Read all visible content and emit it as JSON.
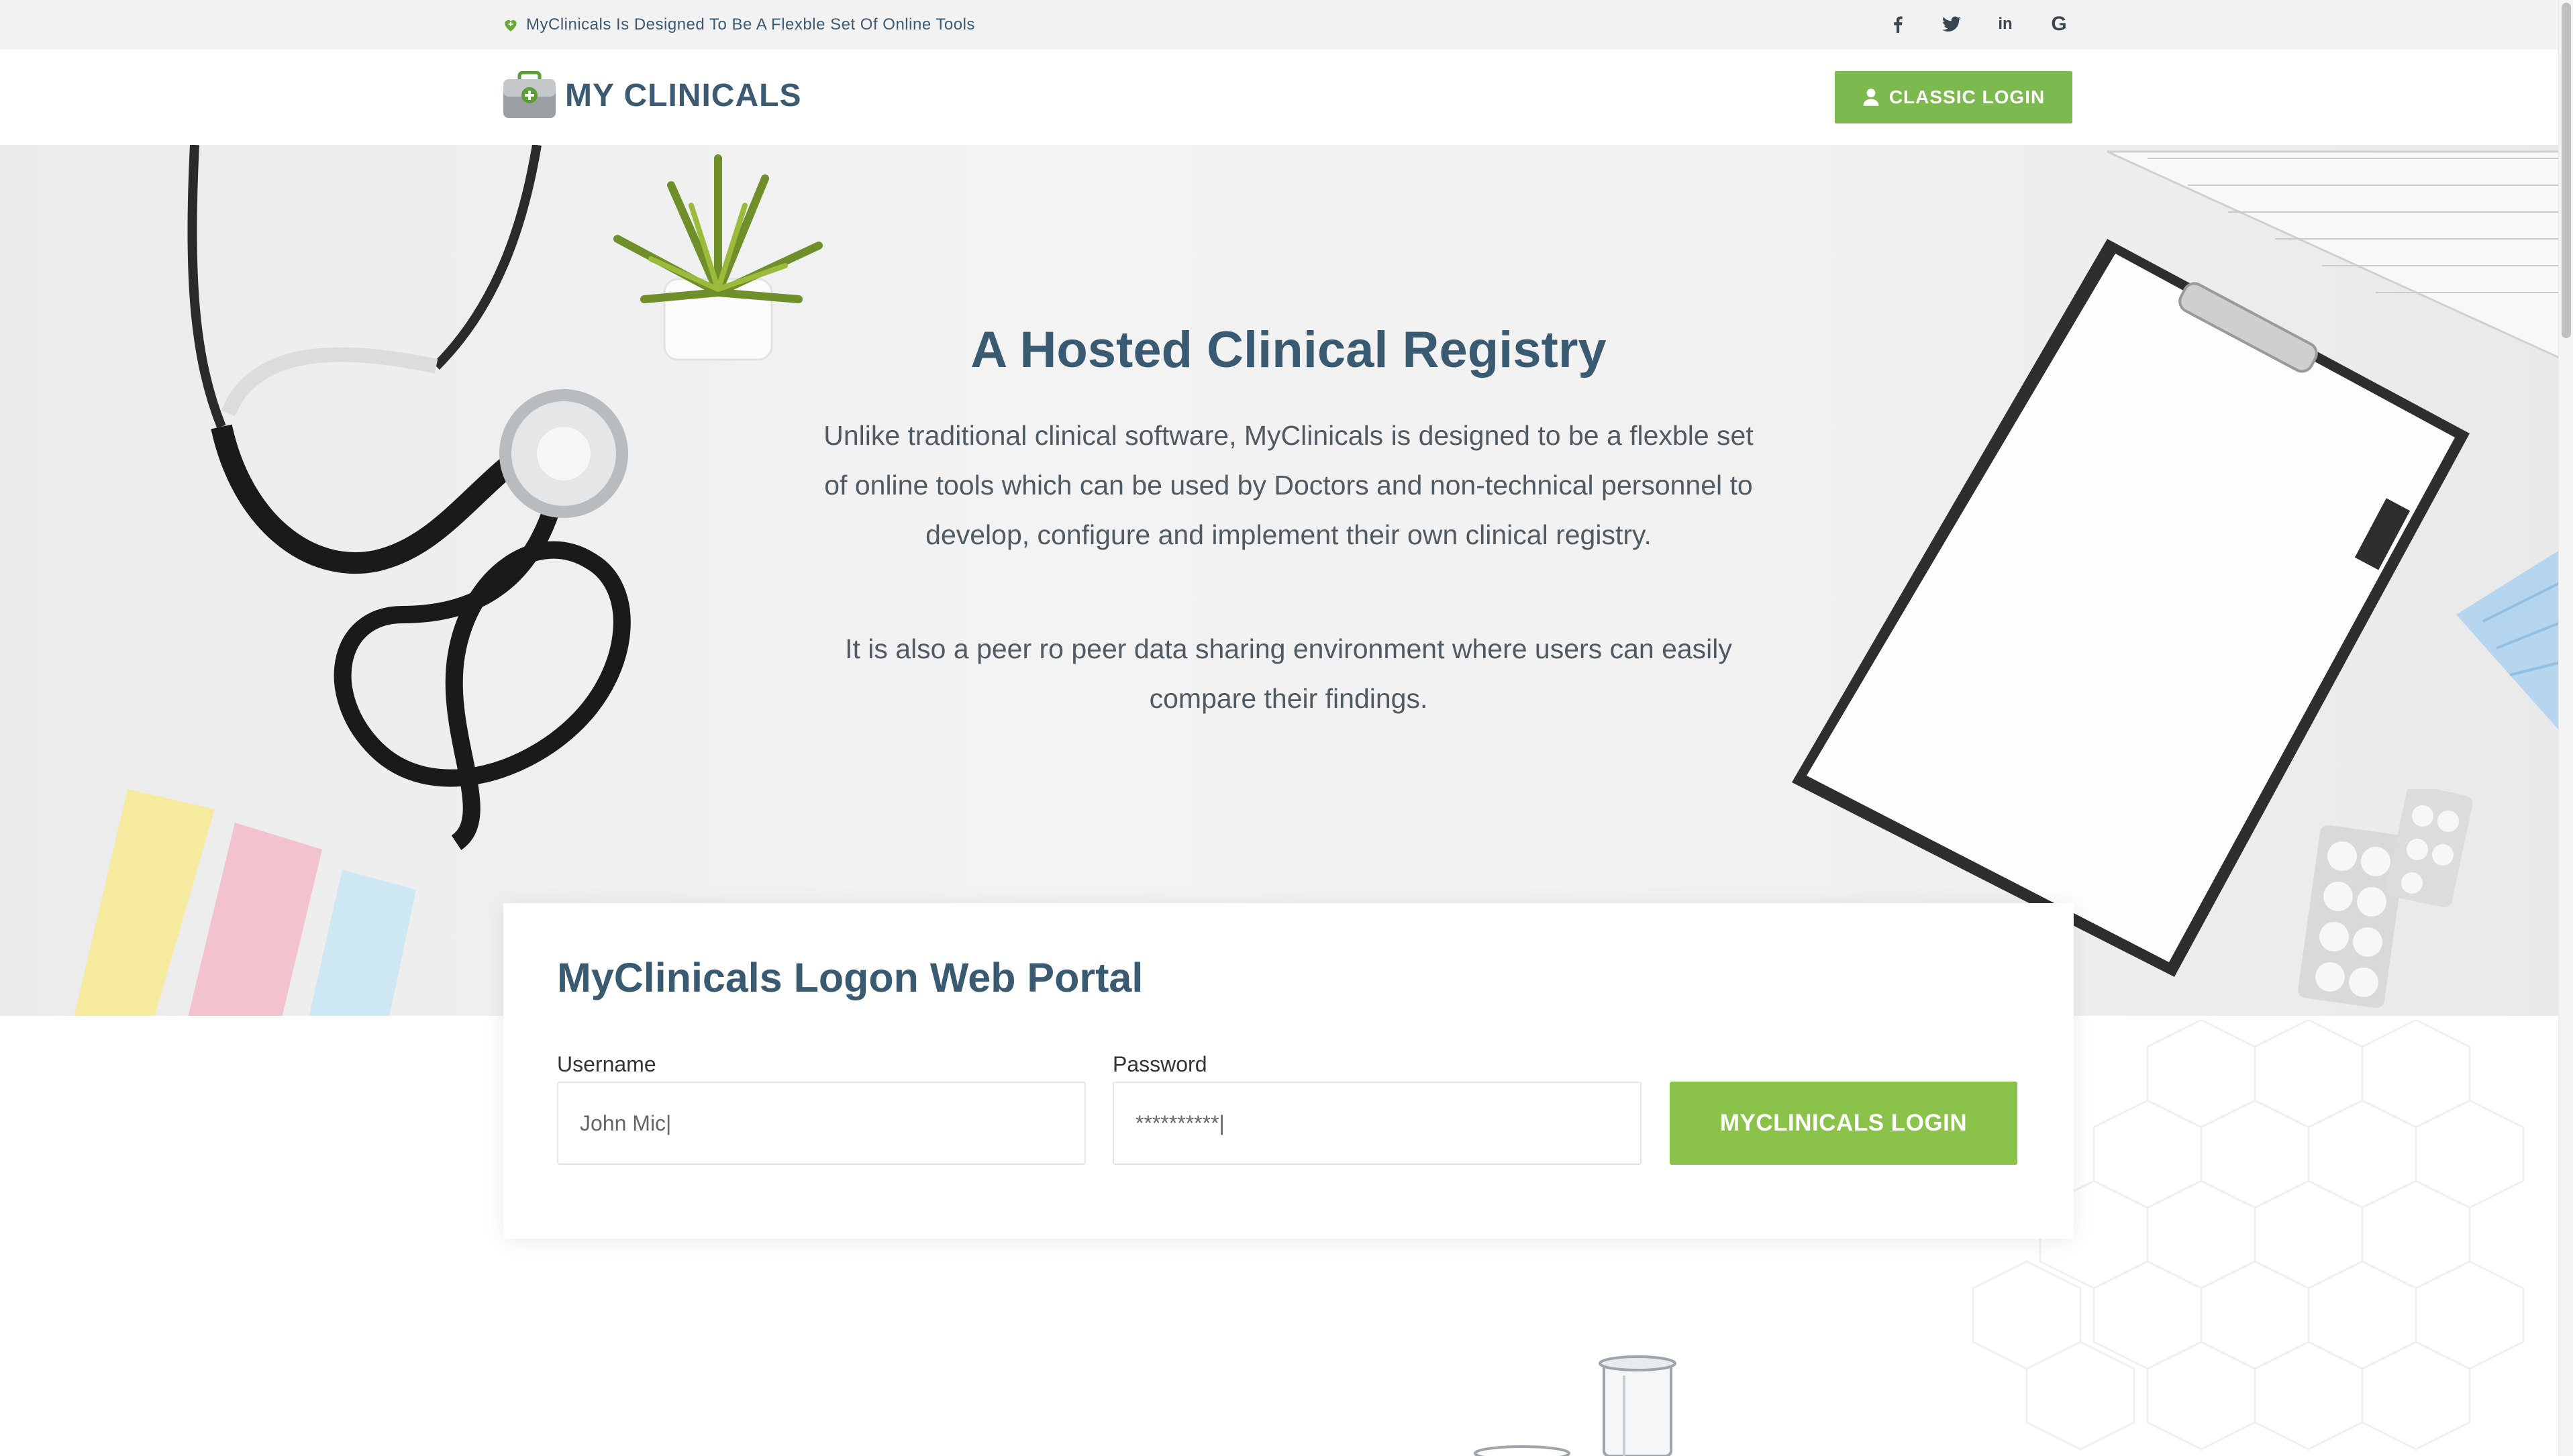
{
  "topbar": {
    "tagline": "MyClinicals Is Designed To Be A Flexble Set Of Online Tools",
    "social": {
      "facebook": "f",
      "twitter": "twitter-icon",
      "linkedin": "in",
      "google": "G"
    }
  },
  "header": {
    "logo_text": "MY CLINICALS",
    "classic_login_label": "CLASSIC LOGIN"
  },
  "hero": {
    "title": "A Hosted Clinical Registry",
    "paragraph1": "Unlike traditional clinical software, MyClinicals is designed to be a flexble set of online tools which can be used by Doctors and non-technical personnel to develop, configure and implement their own clinical registry.",
    "paragraph2": "It is also a peer ro peer data sharing environment where users can easily compare their findings."
  },
  "login_card": {
    "title": "MyClinicals Logon Web Portal",
    "username_label": "Username",
    "username_value": "John Mic|",
    "password_label": "Password",
    "password_value": "**********|",
    "login_button": "MYCLINICALS LOGIN"
  },
  "colors": {
    "brand_blue": "#3c5a72",
    "brand_green": "#8bc34a",
    "classic_green": "#7cb94f"
  }
}
